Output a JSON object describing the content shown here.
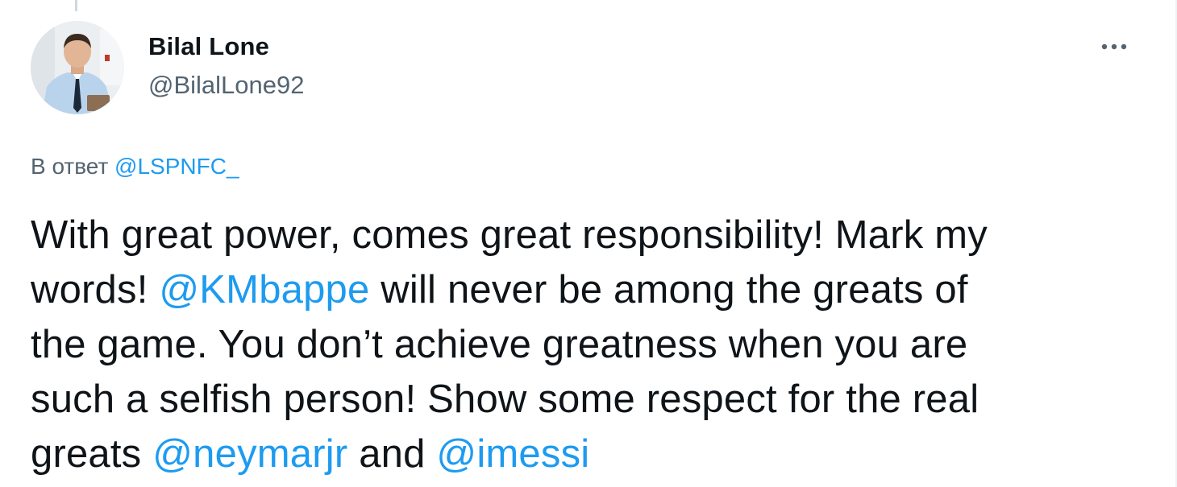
{
  "author": {
    "display_name": "Bilal Lone",
    "handle": "@BilalLone92"
  },
  "icons": {
    "more": "more-horizontal-icon",
    "avatar": "profile-photo"
  },
  "reply": {
    "prefix": "В ответ",
    "mention": "@LSPNFC_"
  },
  "tweet": {
    "line1": "With great power, comes great responsibility! Mark my",
    "line2_prefix": "words!",
    "mention_kmbappe": "@KMbappe",
    "line2_suffix": "will never be among the greats of",
    "line3": "the game. You don’t achieve greatness when you are",
    "line4": "such a selfish person! Show some respect for the real",
    "line5_prefix": "greats",
    "mention_neymar": "@neymarjr",
    "line5_and": "and",
    "mention_messi": "@imessi"
  },
  "colors": {
    "text": "#0f1419",
    "secondary": "#536471",
    "link": "#1d9bf0"
  }
}
